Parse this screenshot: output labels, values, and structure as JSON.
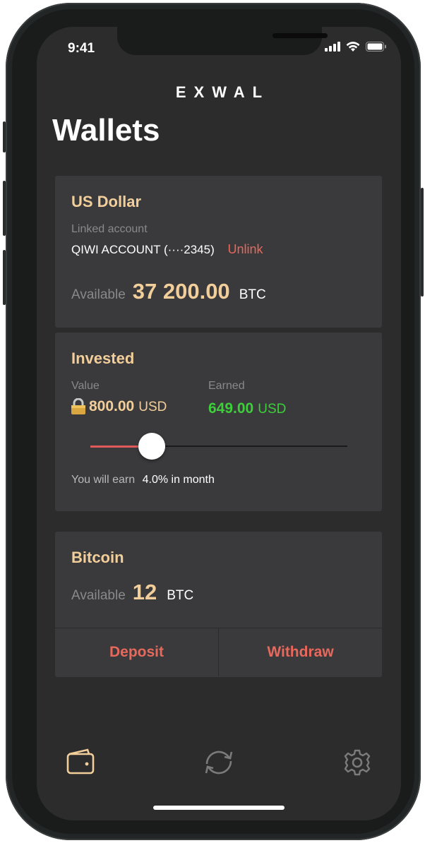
{
  "status_bar": {
    "time": "9:41"
  },
  "brand": "EXWAL",
  "page_title": "Wallets",
  "usd_card": {
    "title": "US Dollar",
    "linked_label": "Linked account",
    "linked_value": "QIWI ACCOUNT (····2345)",
    "unlink_label": "Unlink",
    "available_label": "Available",
    "amount": "37 200.00",
    "currency": "BTC"
  },
  "invested_card": {
    "title": "Invested",
    "value_label": "Value",
    "value_amount": "800.00",
    "value_currency": "USD",
    "earned_label": "Earned",
    "earned_amount": "649.00",
    "earned_currency": "USD",
    "slider_fraction": 0.24,
    "earn_prefix": "You will earn",
    "earn_value": "4.0% in month"
  },
  "bitcoin_card": {
    "title": "Bitcoin",
    "available_label": "Available",
    "amount": "12",
    "currency": "BTC",
    "deposit_label": "Deposit",
    "withdraw_label": "Withdraw"
  },
  "tab_bar": {
    "icons": [
      "wallet-icon",
      "exchange-icon",
      "settings-icon"
    ],
    "active_color": "#f2cf9a",
    "inactive_color": "#7b7b7b"
  },
  "colors": {
    "accent_gold": "#f2cf9a",
    "earned_green": "#3ccf3a",
    "action_red": "#e8695c",
    "card_bg": "#3a393b",
    "screen_bg": "#2c2c2c"
  }
}
